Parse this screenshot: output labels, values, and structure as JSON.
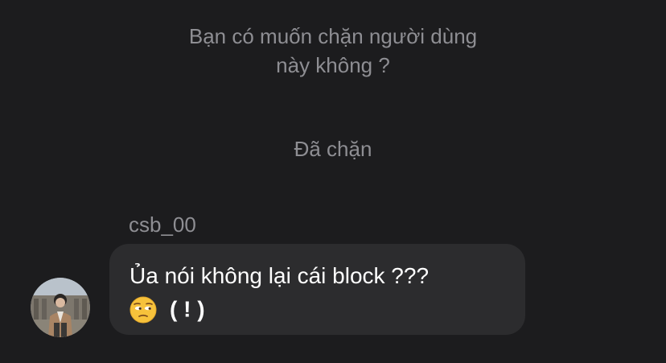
{
  "system": {
    "question": "Bạn có muốn chặn người dùng\nnày không ?",
    "status": "Đã chặn"
  },
  "message": {
    "sender": "csb_00",
    "line1": "Ủa nói không lại cái block ???",
    "emoji_icon": "unamused-face-icon",
    "line2_suffix": "( ! )"
  },
  "colors": {
    "background": "#1c1c1e",
    "bubble": "#2c2c2e",
    "secondary_text": "#8e8e93",
    "primary_text": "#ffffff"
  }
}
